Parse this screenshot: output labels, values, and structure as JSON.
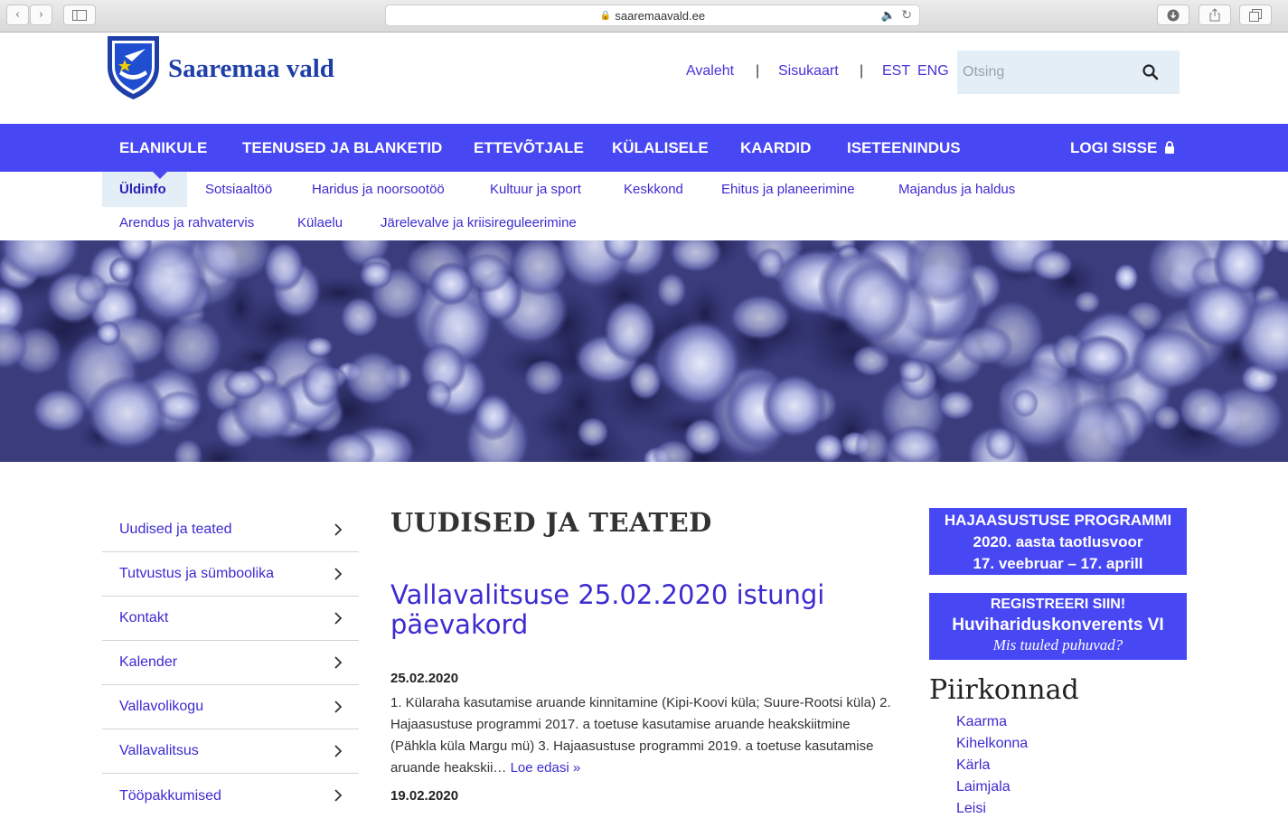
{
  "browser": {
    "url": "saaremaavald.ee"
  },
  "header": {
    "logo_text": "Saaremaa vald",
    "links": {
      "home": "Avaleht",
      "sitemap": "Sisukaart",
      "est": "EST",
      "eng": "ENG"
    },
    "separator": "|",
    "search_placeholder": "Otsing"
  },
  "main_nav": {
    "items": [
      "ELANIKULE",
      "TEENUSED JA BLANKETID",
      "ETTEVÕTJALE",
      "KÜLALISELE",
      "KAARDID",
      "ISETEENINDUS"
    ],
    "login": "LOGI SISSE"
  },
  "sub_nav": {
    "items": [
      "Üldinfo",
      "Sotsiaaltöö",
      "Haridus ja noorsootöö",
      "Kultuur ja sport",
      "Keskkond",
      "Ehitus ja planeerimine",
      "Majandus ja haldus",
      "Arendus ja rahvatervis",
      "Külaelu",
      "Järelevalve ja kriisireguleerimine"
    ],
    "active": "Üldinfo"
  },
  "sidebar": {
    "items": [
      "Uudised ja teated",
      "Tutvustus ja sümboolika",
      "Kontakt",
      "Kalender",
      "Vallavolikogu",
      "Vallavalitsus",
      "Tööpakkumised"
    ]
  },
  "content": {
    "section_title": "UUDISED JA TEATED",
    "article_title": "Vallavalitsuse 25.02.2020 istungi päevakord",
    "date1": "25.02.2020",
    "excerpt": "1. Küla­raha kasutamise aruande kinnitamine (Kipi-Koovi küla; Suure-Rootsi küla) 2. Hajaasustuse programmi 2017. a toetuse kasutamise aruande heakskiitmine (Pähkla küla Margu mü) 3. Hajaasustuse programmi 2019. a toetuse kasutamise aruande heakskii…",
    "read_more": "Loe edasi »",
    "date2": "19.02.2020"
  },
  "right": {
    "banner1": [
      "HAJAASUSTUSE PROGRAMMI",
      "2020. aasta taotlusvoor",
      "17. veebruar – 17. aprill"
    ],
    "banner2": [
      "REGISTREERI SIIN!",
      "Huvihariduskonverents VI",
      "Mis tuuled puhuvad?"
    ],
    "regions_title": "Piirkonnad",
    "regions": [
      "Kaarma",
      "Kihelkonna",
      "Kärla",
      "Laimjala",
      "Leisi"
    ]
  },
  "colors": {
    "brand_blue": "#4847f4",
    "link": "#3b2bd0",
    "light_bg": "#e3eef7"
  }
}
